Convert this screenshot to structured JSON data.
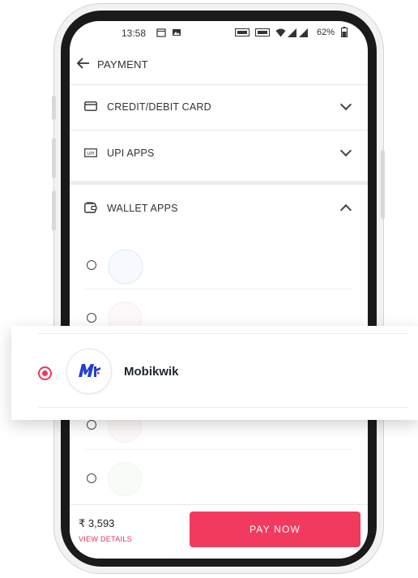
{
  "status_bar": {
    "time": "13:58",
    "battery": "62%"
  },
  "header": {
    "title": "PAYMENT"
  },
  "sections": {
    "card": {
      "label": "CREDIT/DEBIT CARD",
      "expanded": false
    },
    "upi": {
      "label": "UPI APPS",
      "expanded": false,
      "icon_text": "UPI"
    },
    "wallet": {
      "label": "WALLET APPS",
      "expanded": true
    }
  },
  "wallets": {
    "selected": {
      "name": "Mobikwik"
    }
  },
  "footer": {
    "amount": "₹ 3,593",
    "view_details": "VIEW DETAILS",
    "pay_button": "PAY NOW"
  },
  "colors": {
    "accent": "#f23a5e",
    "mobikwik_blue": "#1f3fd4"
  }
}
